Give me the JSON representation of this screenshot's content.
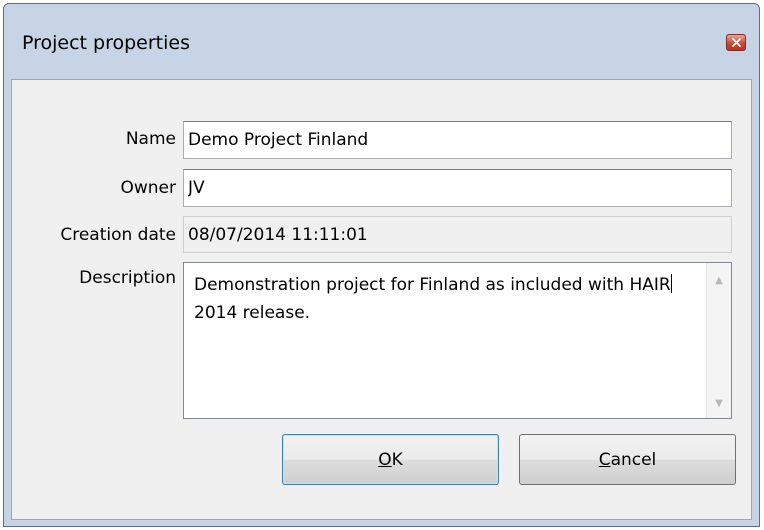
{
  "window": {
    "title": "Project properties"
  },
  "form": {
    "name": {
      "label": "Name",
      "value": "Demo Project Finland"
    },
    "owner": {
      "label": "Owner",
      "value": "JV"
    },
    "creation_date": {
      "label": "Creation date",
      "value": "08/07/2014 11:11:01"
    },
    "description": {
      "label": "Description",
      "text_before_caret": "Demonstration project for Finland as included with HAIR",
      "text_after_caret": "2014 release."
    }
  },
  "buttons": {
    "ok": {
      "accel": "O",
      "rest": "K"
    },
    "cancel": {
      "accel": "C",
      "rest": "ancel"
    }
  },
  "icons": {
    "close": "close-icon",
    "scroll_up": "scroll-up-icon",
    "scroll_down": "scroll-down-icon"
  },
  "colors": {
    "frame": "#c6d4e5",
    "client": "#f0f0f0",
    "close_button": "#c84b3a"
  }
}
